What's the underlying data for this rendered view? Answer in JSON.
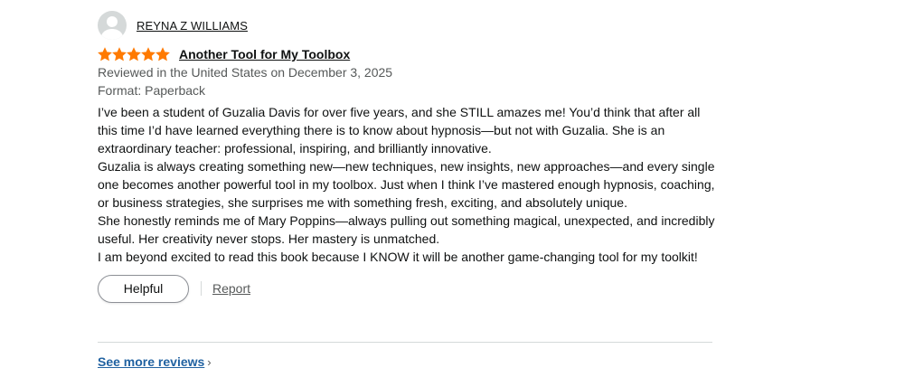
{
  "review": {
    "author": "REYNA Z WILLIAMS",
    "rating": 5,
    "rating_max": 5,
    "star_color": "#ff7a00",
    "title": "Another Tool for My Toolbox",
    "reviewed_line": "Reviewed in the United States on December 3, 2025",
    "format_line": "Format: Paperback",
    "paragraphs": [
      "I’ve been a student of Guzalia Davis for over five years, and she STILL amazes me! You’d think that after all this time I’d have learned everything there is to know about hypnosis—but not with Guzalia. She is an extraordinary teacher: professional, inspiring, and brilliantly innovative.",
      "Guzalia is always creating something new—new techniques, new insights, new approaches—and every single one becomes another powerful tool in my toolbox. Just when I think I’ve mastered enough hypnosis, coaching, or business strategies, she surprises me with something fresh, exciting, and absolutely unique.",
      "She honestly reminds me of Mary Poppins—always pulling out something magical, unexpected, and incredibly useful. Her creativity never stops. Her mastery is unmatched.",
      "I am beyond excited to read this book because I KNOW it will be another game-changing tool for my toolkit!"
    ],
    "helpful_label": "Helpful",
    "report_label": "Report"
  },
  "footer": {
    "see_more_label": "See more reviews",
    "link_color": "#2162a1"
  },
  "icons": {
    "avatar": "default-user-avatar-icon",
    "star": "star-icon",
    "chevron": "chevron-right-icon"
  }
}
